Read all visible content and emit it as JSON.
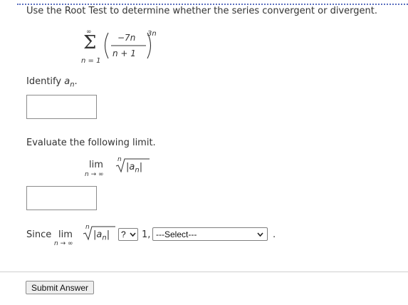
{
  "question": {
    "prompt": "Use the Root Test to determine whether the series convergent or divergent.",
    "series": {
      "sum_lower": "n = 1",
      "sum_upper": "∞",
      "numerator": "−7n",
      "denominator": "n + 1",
      "exponent": "3n"
    }
  },
  "identify": {
    "label": "Identify ",
    "var": "a",
    "sub": "n",
    "suffix": ".",
    "input_value": ""
  },
  "limit_section": {
    "label": "Evaluate the following limit.",
    "lim": "lim",
    "lim_sub": "n → ∞",
    "root_index": "n",
    "abs_expr": "|a",
    "abs_sub": "n",
    "abs_close": "|",
    "input_value": ""
  },
  "since": {
    "label": "Since",
    "lim": "lim",
    "lim_sub": "n → ∞",
    "root_index": "n",
    "abs_expr": "|a",
    "abs_sub": "n",
    "abs_close": "|",
    "compare_value": "?",
    "after": "1,",
    "conclusion_value": "---Select---",
    "end": "."
  },
  "submit": {
    "label": "Submit Answer"
  }
}
